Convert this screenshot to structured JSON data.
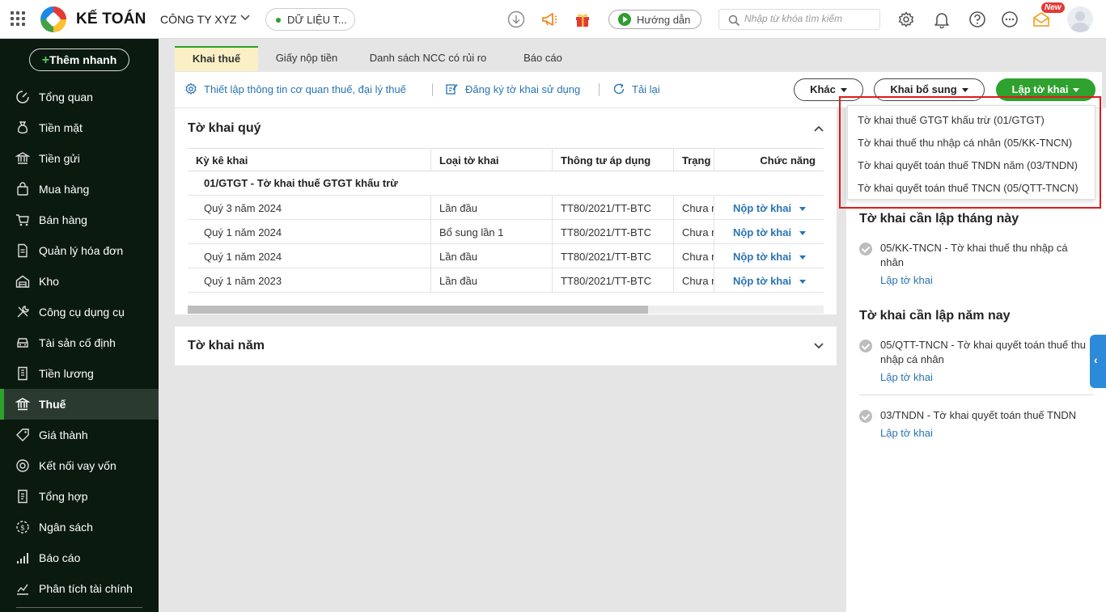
{
  "header": {
    "brand": "KẾ TOÁN",
    "company": "CÔNG TY XYZ",
    "data_label": "DỮ LIỆU T...",
    "guide_label": "Hướng dẫn",
    "search_placeholder": "Nhập từ khóa tìm kiếm",
    "new_badge": "New"
  },
  "sidebar": {
    "quick_add": "Thêm nhanh",
    "items": [
      {
        "label": "Tổng quan",
        "icon": "dashboard-icon"
      },
      {
        "label": "Tiền mặt",
        "icon": "cash-bag-icon"
      },
      {
        "label": "Tiền gửi",
        "icon": "bank-deposit-icon"
      },
      {
        "label": "Mua hàng",
        "icon": "shopping-bag-icon"
      },
      {
        "label": "Bán hàng",
        "icon": "cart-icon"
      },
      {
        "label": "Quản lý hóa đơn",
        "icon": "invoice-icon"
      },
      {
        "label": "Kho",
        "icon": "warehouse-icon"
      },
      {
        "label": "Công cụ dụng cụ",
        "icon": "tools-icon"
      },
      {
        "label": "Tài sản cố định",
        "icon": "car-icon"
      },
      {
        "label": "Tiền lương",
        "icon": "salary-icon"
      },
      {
        "label": "Thuế",
        "icon": "tax-bank-icon"
      },
      {
        "label": "Giá thành",
        "icon": "price-tag-icon"
      },
      {
        "label": "Kết nối vay vốn",
        "icon": "loan-icon"
      },
      {
        "label": "Tổng hợp",
        "icon": "summary-icon"
      },
      {
        "label": "Ngân sách",
        "icon": "budget-icon"
      },
      {
        "label": "Báo cáo",
        "icon": "bar-chart-icon"
      },
      {
        "label": "Phân tích tài chính",
        "icon": "analytics-icon"
      }
    ]
  },
  "tabs": [
    "Khai thuế",
    "Giấy nộp tiền",
    "Danh sách NCC có rủi ro",
    "Báo cáo"
  ],
  "toolbar": {
    "setup": "Thiết lập thông tin cơ quan thuế, đại lý thuế",
    "register": "Đăng ký tờ khai sử dụng",
    "reload": "Tải lại",
    "other": "Khác",
    "supplement": "Khai bổ sung",
    "create": "Lập tờ khai"
  },
  "quarterly": {
    "title": "Tờ khai quý",
    "columns": [
      "Kỳ kê khai",
      "Loại tờ khai",
      "Thông tư áp dụng",
      "Trạng thái",
      "Chức năng"
    ],
    "group": "01/GTGT - Tờ khai thuế GTGT khấu trừ",
    "rows": [
      {
        "period": "Quý 3 năm 2024",
        "type": "Lần đầu",
        "circular": "TT80/2021/TT-BTC",
        "status": "Chưa nộp",
        "action": "Nộp tờ khai"
      },
      {
        "period": "Quý 1 năm 2024",
        "type": "Bổ sung lần 1",
        "circular": "TT80/2021/TT-BTC",
        "status": "Chưa nộp",
        "action": "Nộp tờ khai"
      },
      {
        "period": "Quý 1 năm 2024",
        "type": "Lần đầu",
        "circular": "TT80/2021/TT-BTC",
        "status": "Chưa nộp",
        "action": "Nộp tờ khai"
      },
      {
        "period": "Quý 1 năm 2023",
        "type": "Lần đầu",
        "circular": "TT80/2021/TT-BTC",
        "status": "Chưa nộp",
        "action": "Nộp tờ khai"
      }
    ]
  },
  "yearly": {
    "title": "Tờ khai năm"
  },
  "dropdown": {
    "items": [
      "Tờ khai thuế GTGT khấu trừ (01/GTGT)",
      "Tờ khai thuế thu nhập cá nhân (05/KK-TNCN)",
      "Tờ khai quyết toán thuế TNDN năm (03/TNDN)",
      "Tờ khai quyết toán thuế TNCN (05/QTT-TNCN)"
    ]
  },
  "right": {
    "month_title": "Tờ khai cần lập tháng này",
    "month_items": [
      {
        "text": "05/KK-TNCN - Tờ khai thuế thu nhập cá nhân",
        "link": "Lập tờ khai"
      }
    ],
    "year_title": "Tờ khai cần lập năm nay",
    "year_items": [
      {
        "text": "05/QTT-TNCN - Tờ khai quyết toán thuế thu nhập cá nhân",
        "link": "Lập tờ khai"
      },
      {
        "text": "03/TNDN - Tờ khai quyết toán thuế TNDN",
        "link": "Lập tờ khai"
      }
    ]
  },
  "colors": {
    "accent_green": "#2ea12e",
    "link_blue": "#2874b4",
    "sidebar_bg": "#0b1a0f",
    "highlight_red": "#e01a1a"
  }
}
